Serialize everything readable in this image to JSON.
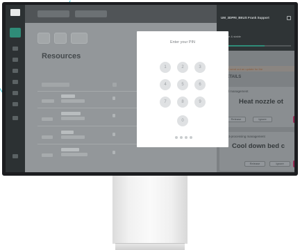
{
  "app": {
    "logo": "",
    "tabs": [
      "",
      ""
    ]
  },
  "filters": [
    "",
    "",
    ""
  ],
  "resources": {
    "title": "Resources",
    "rows": [
      {
        "name": "",
        "detail": ""
      },
      {
        "name": "",
        "detail": ""
      },
      {
        "name": "",
        "detail": ""
      },
      {
        "name": "",
        "detail": ""
      }
    ]
  },
  "pin_modal": {
    "title": "Enter your PIN",
    "keys": [
      "1",
      "2",
      "3",
      "4",
      "5",
      "6",
      "7",
      "8",
      "9",
      "0"
    ],
    "entered_count": 0,
    "length": 4
  },
  "panel": {
    "title": "UM_3DPRI_BEUS Frank Support",
    "status": "Live & stable",
    "progress_percent": 62,
    "warning": "Please send out an update for the",
    "details_label": "DETAILS",
    "section1_label": "Bed management",
    "section1_action": "Heat nozzle ot",
    "section1_buttons": [
      "Release",
      "Ignore"
    ],
    "section2_label": "Post-processing management",
    "section2_action": "Cool down bed c",
    "section2_buttons": [
      "Release",
      "Ignore"
    ],
    "accent_color": "#9a2a55",
    "brand_color": "#2f8c78"
  }
}
